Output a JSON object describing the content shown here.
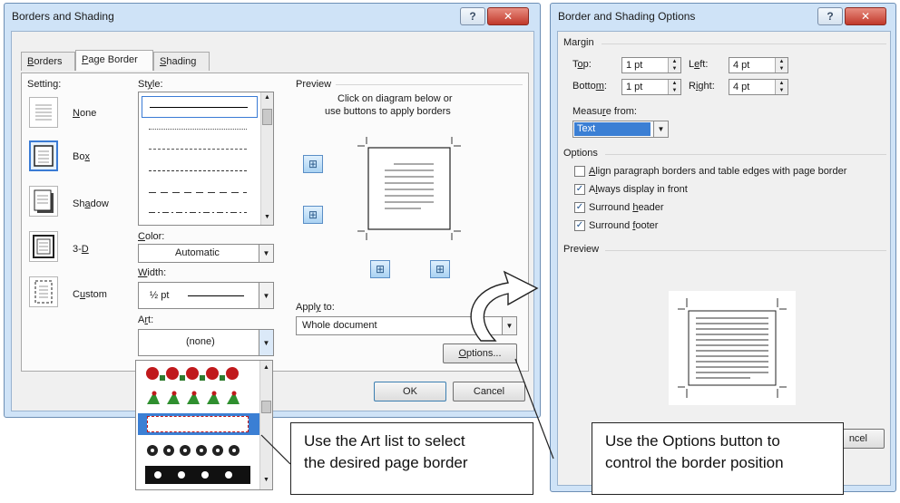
{
  "left_dialog": {
    "title": "Borders and Shading",
    "tabs": [
      {
        "label": "Borders",
        "accel": "B",
        "rest": "orders"
      },
      {
        "label": "Page Border",
        "accel": "P",
        "rest": "age Border"
      },
      {
        "label": "Shading",
        "accel": "S",
        "rest": "hading"
      }
    ],
    "setting_label": "Setting:",
    "settings": [
      {
        "label": "None",
        "accel": "N",
        "rest": "one"
      },
      {
        "label": "Box",
        "pre": "Bo",
        "accel": "x",
        "rest": ""
      },
      {
        "label": "Shadow",
        "pre": "Sh",
        "accel": "a",
        "rest": "dow"
      },
      {
        "label": "3-D",
        "pre": "3-",
        "accel": "D",
        "rest": ""
      },
      {
        "label": "Custom",
        "pre": "C",
        "accel": "u",
        "rest": "stom"
      }
    ],
    "style_label_pre": "St",
    "style_label_accel": "y",
    "style_label_rest": "le:",
    "color_label_accel": "C",
    "color_label_rest": "olor:",
    "color_value": "Automatic",
    "width_label_accel": "W",
    "width_label_rest": "idth:",
    "width_value": "½ pt",
    "art_label_pre": "A",
    "art_label_accel": "r",
    "art_label_rest": "t:",
    "art_value": "(none)",
    "preview_label": "Preview",
    "preview_hint_line1": "Click on diagram below or",
    "preview_hint_line2": "use buttons to apply borders",
    "apply_to_label_pre": "Appl",
    "apply_to_label_accel": "y",
    "apply_to_label_rest": " to:",
    "apply_to_value": "Whole document",
    "options_button_accel": "O",
    "options_button_rest": "ptions...",
    "ok_button": "OK",
    "cancel_button": "Cancel",
    "close_glyph": "✕",
    "help_glyph": "?"
  },
  "right_dialog": {
    "title": "Border and Shading Options",
    "margin_label": "Margin",
    "top_label_pre": "T",
    "top_label_accel": "o",
    "top_label_rest": "p:",
    "top_value": "1 pt",
    "left_label_pre": "L",
    "left_label_accel": "e",
    "left_label_rest": "ft:",
    "left_value": "4 pt",
    "bottom_label_pre": "Botto",
    "bottom_label_accel": "m",
    "bottom_label_rest": ":",
    "bottom_value": "1 pt",
    "right_label_pre": "R",
    "right_label_accel": "i",
    "right_label_rest": "ght:",
    "right_value": "4 pt",
    "measure_from_label_pre": "Measu",
    "measure_from_label_accel": "r",
    "measure_from_label_rest": "e from:",
    "measure_from_value": "Text",
    "options_label": "Options",
    "checkboxes": [
      {
        "pre": "",
        "accel": "A",
        "rest": "lign paragraph borders and table edges with page border",
        "checked": false
      },
      {
        "pre": "A",
        "accel": "l",
        "rest": "ways display in front",
        "checked": true
      },
      {
        "pre": "Surround ",
        "accel": "h",
        "rest": "eader",
        "checked": true
      },
      {
        "pre": "Surround ",
        "accel": "f",
        "rest": "ooter",
        "checked": true
      }
    ],
    "preview_label": "Preview",
    "cancel_partial": "ncel",
    "close_glyph": "✕",
    "help_glyph": "?"
  },
  "callouts": {
    "art_line1": "Use the Art list to select",
    "art_line2": "the desired page border",
    "options_line1": "Use the Options button to",
    "options_line2": "control the border position"
  },
  "colors": {
    "accent": "#3a7bd5",
    "selection": "#3b7fd4",
    "window_frame": "#cfe3f7",
    "close_red": "#c1392b"
  }
}
